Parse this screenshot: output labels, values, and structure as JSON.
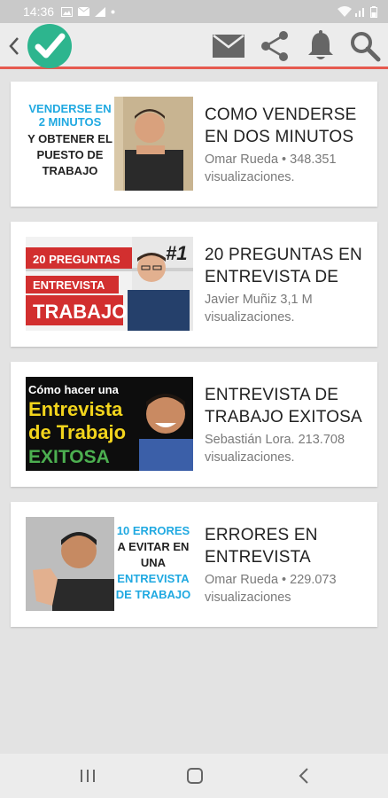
{
  "status_bar": {
    "time": "14:36"
  },
  "toolbar": {
    "icons": [
      "back-icon",
      "check-logo-icon",
      "mail-icon",
      "share-icon",
      "bell-icon",
      "search-icon"
    ],
    "accent_color": "#e65a4f",
    "logo_color": "#2db58e"
  },
  "videos": [
    {
      "title": "COMO VENDERSE EN DOS MINUTOS",
      "meta": "Omar Rueda • 348.351 visualizaciones.",
      "thumb_text": [
        "VENDERSE EN",
        "2 MINUTOS",
        "Y OBTENER EL",
        "PUESTO DE",
        "TRABAJO"
      ]
    },
    {
      "title": "20 PREGUNTAS EN ENTREVISTA DE",
      "meta": "Javier Muñiz 3,1 M visualizaciones.",
      "thumb_text": [
        "20 PREGUNTAS",
        "ENTREVISTA",
        "TRABAJO",
        "#1"
      ]
    },
    {
      "title": "ENTREVISTA DE TRABAJO EXITOSA",
      "meta": "Sebastián Lora. 213.708 visualizaciones.",
      "thumb_text": [
        "Cómo hacer una",
        "Entrevista",
        "de Trabajo",
        "EXITOSA"
      ]
    },
    {
      "title": "ERRORES EN ENTREVISTA",
      "meta": "Omar Rueda • 229.073 visualizaciones",
      "thumb_text": [
        "10 ERRORES",
        "A EVITAR EN",
        "UNA",
        "ENTREVISTA",
        "DE TRABAJO"
      ]
    }
  ]
}
